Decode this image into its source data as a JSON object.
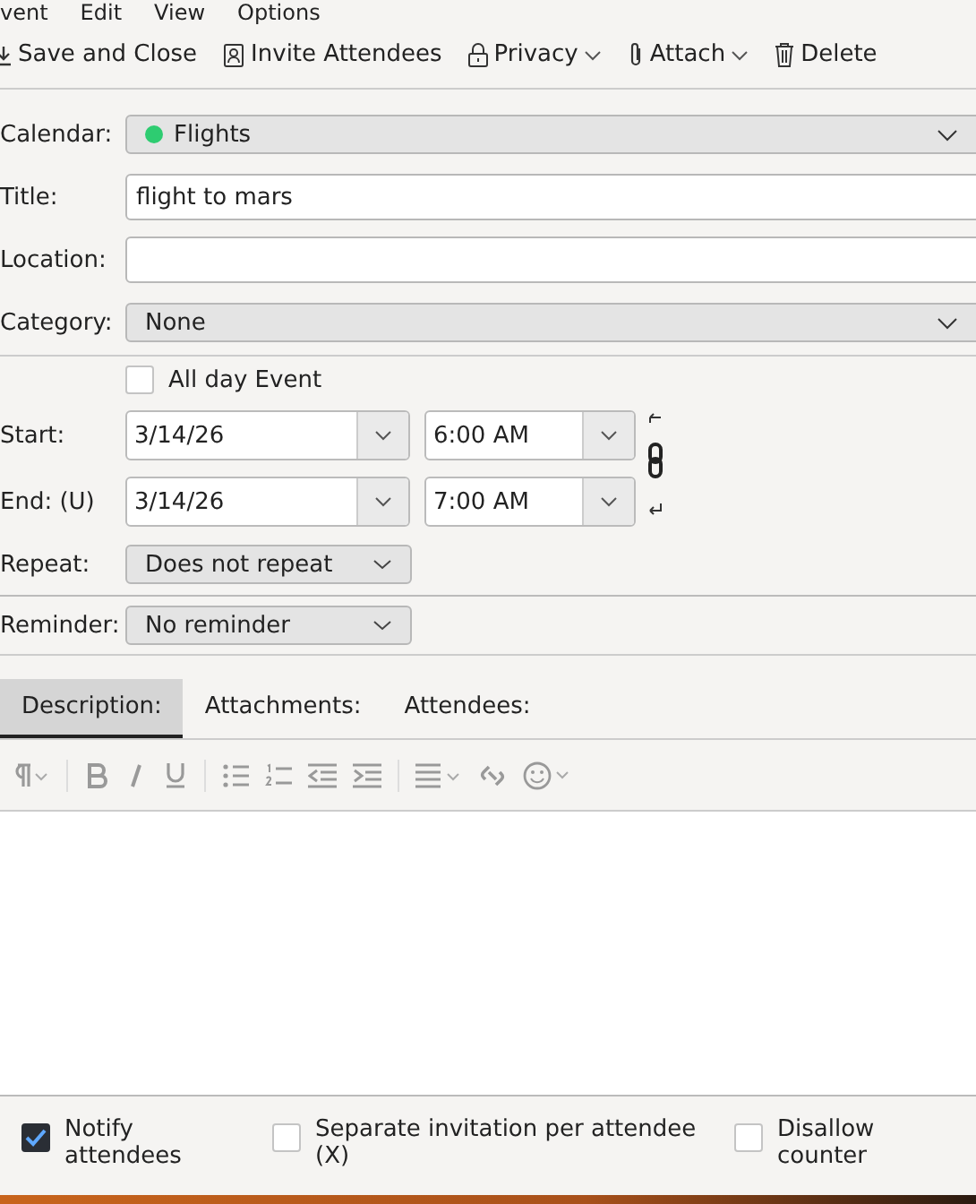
{
  "menu": [
    "vent",
    "Edit",
    "View",
    "Options"
  ],
  "toolbar": [
    {
      "kind": "save",
      "label": "Save and Close",
      "dropdown": false
    },
    {
      "kind": "invite",
      "label": "Invite Attendees",
      "dropdown": false
    },
    {
      "kind": "privacy",
      "label": "Privacy",
      "dropdown": true
    },
    {
      "kind": "attach",
      "label": "Attach",
      "dropdown": true
    },
    {
      "kind": "delete",
      "label": "Delete",
      "dropdown": false
    }
  ],
  "calendar": {
    "label": "Calendar:",
    "value": "Flights",
    "color": "#2ecc71"
  },
  "title": {
    "label": "Title:",
    "value": "flight to mars"
  },
  "location": {
    "label": "Location:"
  },
  "category": {
    "label": "Category:",
    "value": "None"
  },
  "all_day": {
    "label": "All day Event",
    "checked": false
  },
  "start": {
    "label": "Start:",
    "date": "3/14/26",
    "time": "6:00 AM"
  },
  "end": {
    "label": "End: (U)",
    "date": "3/14/26",
    "time": "7:00 AM"
  },
  "repeat": {
    "label": "Repeat:",
    "value": "Does not repeat"
  },
  "reminder": {
    "label": "Reminder:",
    "value": "No reminder"
  },
  "tabs": [
    {
      "label": "Description:",
      "selected": true
    },
    {
      "label": "Attachments:",
      "selected": false
    },
    {
      "label": "Attendees:",
      "selected": false
    }
  ],
  "options": [
    {
      "label": "Notify attendees",
      "checked": true
    },
    {
      "label": "Separate invitation per attendee (X)",
      "checked": false
    },
    {
      "label": "Disallow counter",
      "checked": false
    }
  ]
}
